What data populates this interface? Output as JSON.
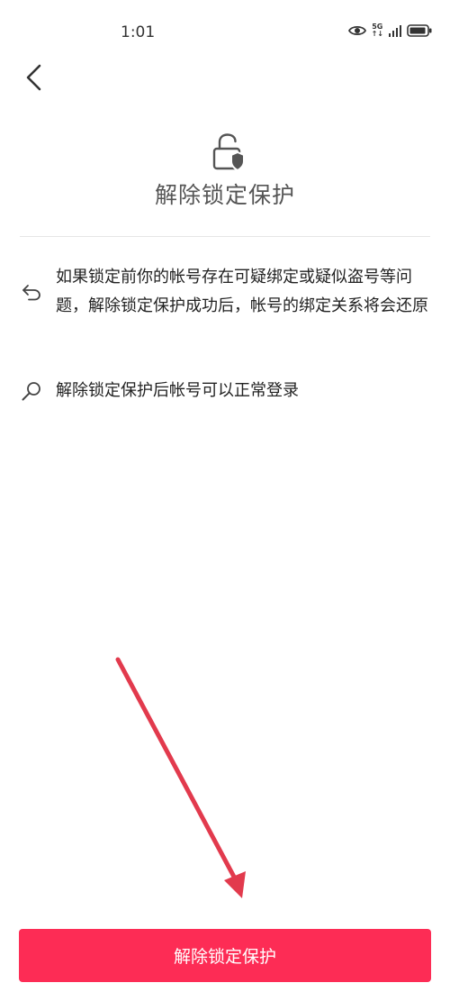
{
  "status_bar": {
    "time": "1:01",
    "signal_label_top": "5G",
    "signal_label_bottom": "↑↓"
  },
  "header": {
    "title": "解除锁定保护"
  },
  "info_items": [
    {
      "icon": "undo-arrow-icon",
      "text": "如果锁定前你的帐号存在可疑绑定或疑似盗号等问题，解除锁定保护成功后，帐号的绑定关系将会还原"
    },
    {
      "icon": "search-key-icon",
      "text": "解除锁定保护后帐号可以正常登录"
    }
  ],
  "primary_action": {
    "label": "解除锁定保护"
  },
  "colors": {
    "accent": "#fd2c55",
    "annotation_arrow": "#e23a4d"
  }
}
